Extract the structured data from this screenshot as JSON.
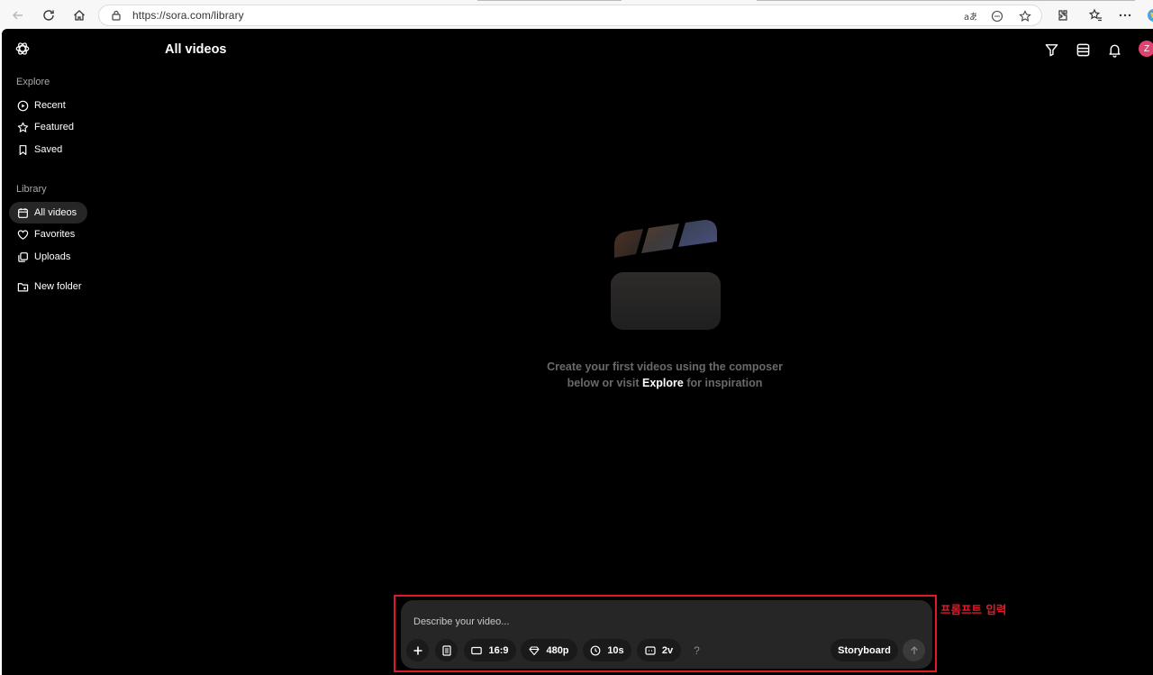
{
  "browser": {
    "url": "https://sora.com/library"
  },
  "app": {
    "page_title": "All videos",
    "avatar_letter": "Z",
    "accent_avatar": "#e0436e"
  },
  "sidebar": {
    "explore_heading": "Explore",
    "explore_items": [
      {
        "label": "Recent",
        "icon": "play-circle-icon"
      },
      {
        "label": "Featured",
        "icon": "star-icon"
      },
      {
        "label": "Saved",
        "icon": "bookmark-icon"
      }
    ],
    "library_heading": "Library",
    "library_items": [
      {
        "label": "All videos",
        "icon": "calendar-icon",
        "active": true
      },
      {
        "label": "Favorites",
        "icon": "heart-icon"
      },
      {
        "label": "Uploads",
        "icon": "uploads-icon"
      }
    ],
    "new_folder_label": "New folder"
  },
  "empty_state": {
    "line1": "Create your first videos using the composer",
    "line2_before": "below or visit",
    "line2_link": "Explore",
    "line2_after": "for inspiration"
  },
  "composer": {
    "placeholder": "Describe your video...",
    "aspect_ratio": "16:9",
    "resolution": "480p",
    "duration": "10s",
    "variations": "2v",
    "help": "?",
    "storyboard_label": "Storyboard"
  },
  "annotation": {
    "label": "프롬프트 입력",
    "color": "#e0192a"
  }
}
